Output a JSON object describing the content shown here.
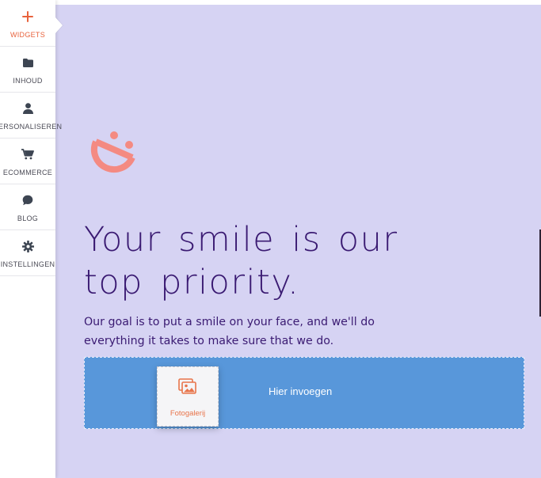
{
  "sidebar": {
    "items": [
      {
        "label": "WIDGETS",
        "icon": "plus-icon"
      },
      {
        "label": "INHOUD",
        "icon": "folder-icon"
      },
      {
        "label": "PERSONALISEREN",
        "icon": "user-icon"
      },
      {
        "label": "ECOMMERCE",
        "icon": "cart-icon"
      },
      {
        "label": "BLOG",
        "icon": "chat-bubble-icon"
      },
      {
        "label": "INSTELLINGEN",
        "icon": "gear-icon"
      }
    ],
    "active_index": 0
  },
  "hero": {
    "headline_line1": "Your smile is our",
    "headline_line2": "top priority.",
    "subtext_line1": "Our goal is to put a smile on your face, and we'll do",
    "subtext_line2": "everything it takes to make sure that we do."
  },
  "dropzone": {
    "label": "Hier invoegen"
  },
  "dragged_widget": {
    "label": "Fotogalerij",
    "icon": "photo-gallery-icon"
  },
  "colors": {
    "canvas_bg": "#d6d3f3",
    "headline": "#3a1a72",
    "accent": "#e8623c",
    "logo": "#f48a82",
    "dropzone_bg": "#5897da"
  }
}
